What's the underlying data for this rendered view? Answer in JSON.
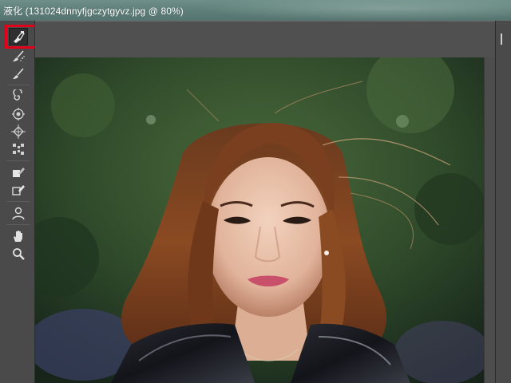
{
  "window": {
    "title": "液化 (131024dnnyfjgczytgyvz.jpg @ 80%)"
  },
  "toolbar": {
    "tools": [
      {
        "name": "forward-warp-tool",
        "icon": "warp-hand-icon",
        "active": true
      },
      {
        "name": "reconstruct-tool",
        "icon": "reconstruct-brush-icon"
      },
      {
        "name": "smooth-tool",
        "icon": "smooth-brush-icon"
      },
      {
        "name": "twirl-clockwise-tool",
        "icon": "twirl-icon"
      },
      {
        "name": "pucker-tool",
        "icon": "pucker-icon"
      },
      {
        "name": "bloat-tool",
        "icon": "bloat-icon"
      },
      {
        "name": "push-left-tool",
        "icon": "push-left-icon"
      },
      {
        "name": "freeze-mask-tool",
        "icon": "freeze-mask-icon"
      },
      {
        "name": "thaw-mask-tool",
        "icon": "thaw-mask-icon"
      },
      {
        "name": "face-tool",
        "icon": "face-person-icon"
      },
      {
        "name": "hand-tool",
        "icon": "hand-icon"
      },
      {
        "name": "zoom-tool",
        "icon": "zoom-magnifier-icon"
      }
    ]
  },
  "colors": {
    "active_highlight": "#e3001b",
    "panel_bg": "#4a4a4a",
    "canvas_bg": "#535353",
    "title_bg": "#5d7d78"
  }
}
